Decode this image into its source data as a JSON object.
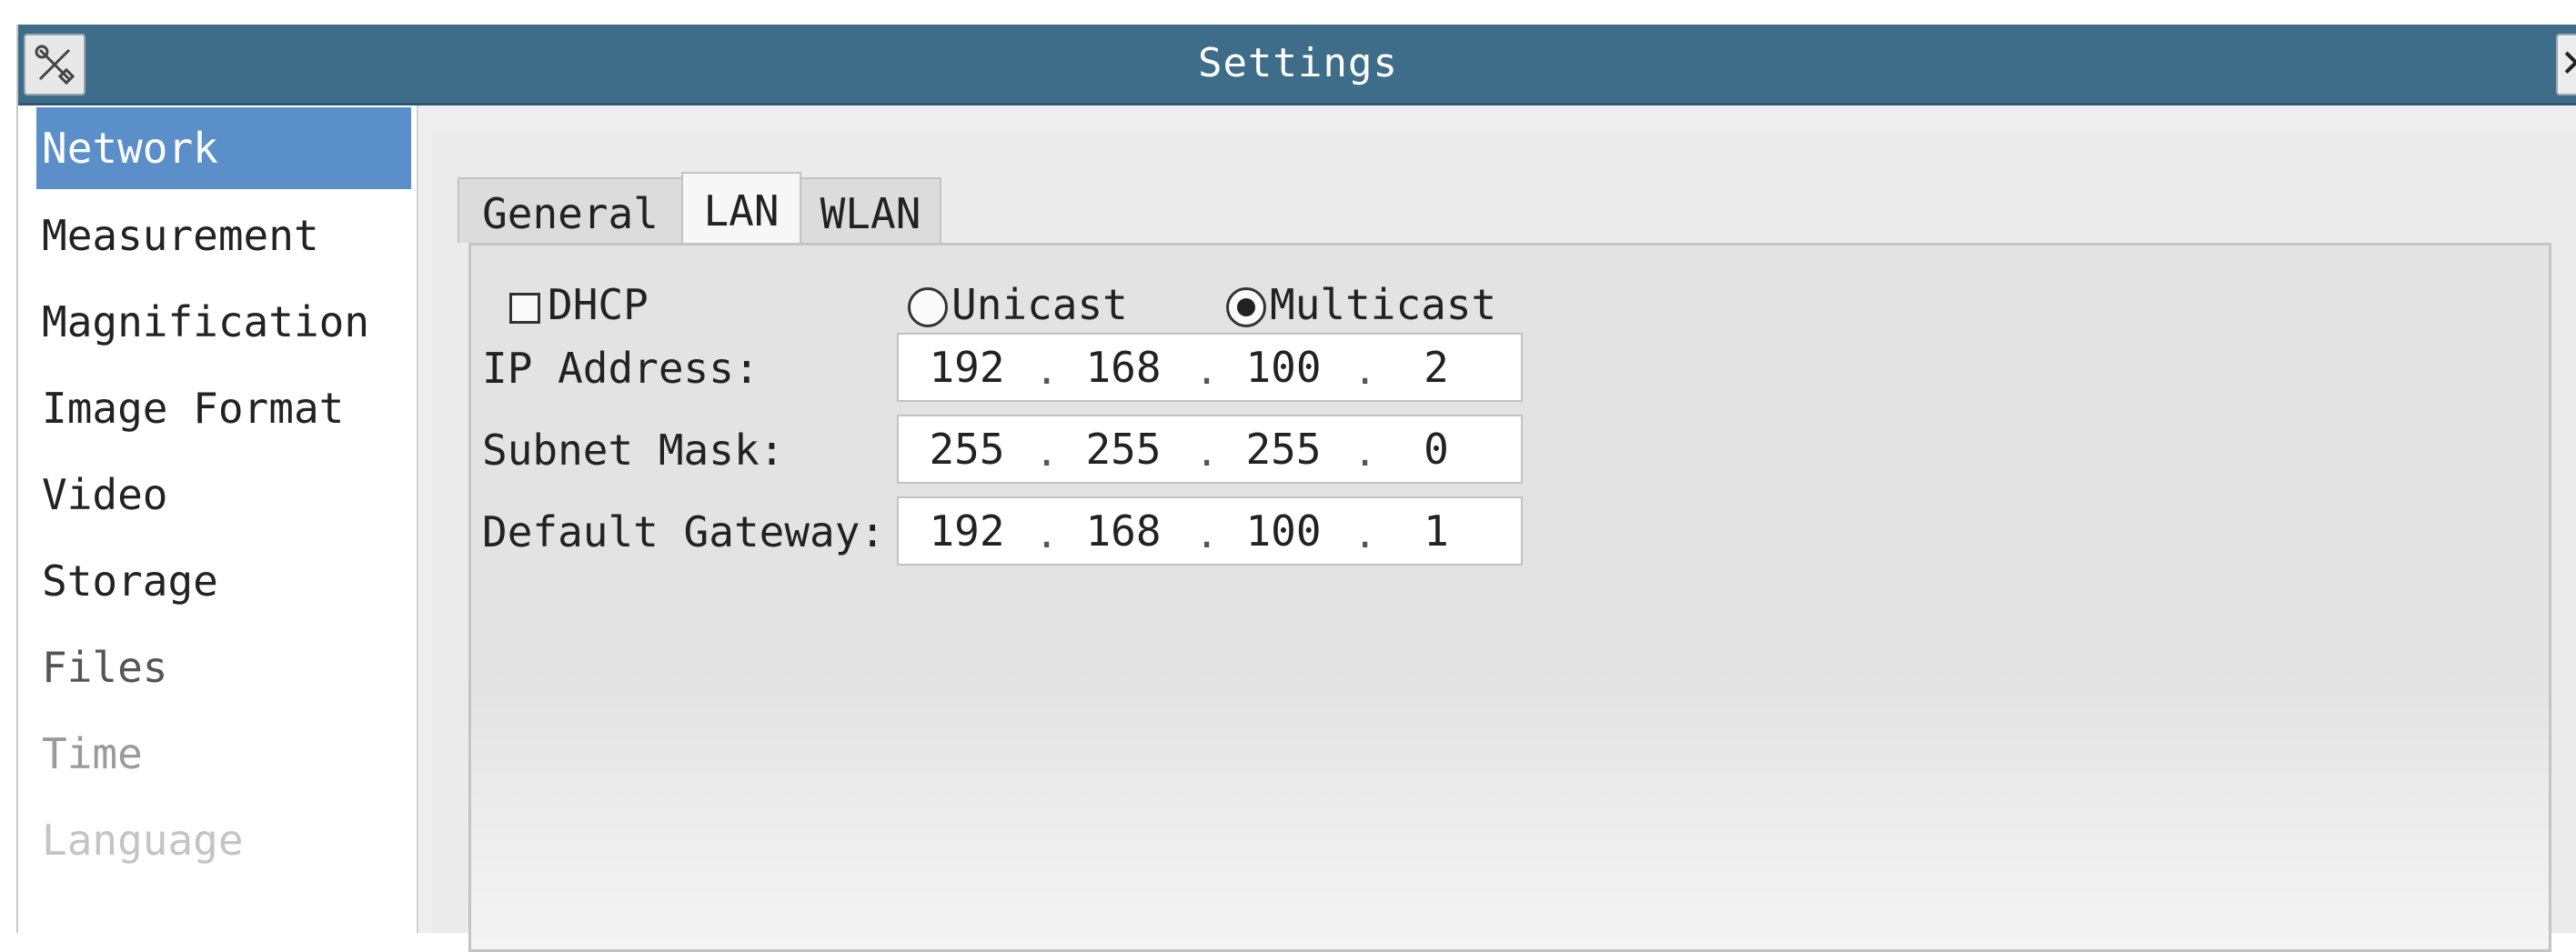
{
  "window": {
    "title": "Settings",
    "app_icon": "tools-icon",
    "close_glyph": "✕"
  },
  "sidebar": {
    "items": [
      {
        "label": "Network",
        "selected": true
      },
      {
        "label": "Measurement"
      },
      {
        "label": "Magnification"
      },
      {
        "label": "Image Format"
      },
      {
        "label": "Video"
      },
      {
        "label": "Storage"
      },
      {
        "label": "Files"
      },
      {
        "label": "Time"
      },
      {
        "label": "Language"
      }
    ]
  },
  "tabs": [
    {
      "label": "General"
    },
    {
      "label": "LAN",
      "active": true
    },
    {
      "label": "WLAN"
    }
  ],
  "lan": {
    "dhcp": {
      "label": "DHCP",
      "checked": false
    },
    "mode": {
      "unicast_label": "Unicast",
      "multicast_label": "Multicast",
      "selected": "Multicast"
    },
    "ip_address": {
      "label": "IP Address:",
      "octets": [
        "192",
        "168",
        "100",
        "2"
      ]
    },
    "subnet_mask": {
      "label": "Subnet Mask:",
      "octets": [
        "255",
        "255",
        "255",
        "0"
      ]
    },
    "default_gateway": {
      "label": "Default Gateway:",
      "octets": [
        "192",
        "168",
        "100",
        "1"
      ]
    },
    "separator": "."
  },
  "colors": {
    "titlebar": "#3e6d8a",
    "selection": "#5b8fc9"
  }
}
